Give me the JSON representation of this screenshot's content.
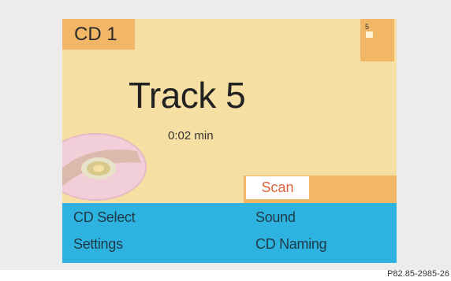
{
  "source": {
    "label": "CD 1"
  },
  "indicator": {
    "label": "5"
  },
  "track": {
    "title": "Track 5",
    "time": "0:02 min"
  },
  "disc": {
    "icon": "disc-icon"
  },
  "scan": {
    "label": "Scan"
  },
  "menu": {
    "cd_select": "CD Select",
    "sound": "Sound",
    "settings": "Settings",
    "cd_naming": "CD Naming"
  },
  "caption": "P82.85-2985-26",
  "colors": {
    "screen_bg": "#f5dfa3",
    "accent_orange": "#f2b766",
    "menu_blue": "#2eb3e1",
    "scan_text": "#e0623d"
  }
}
